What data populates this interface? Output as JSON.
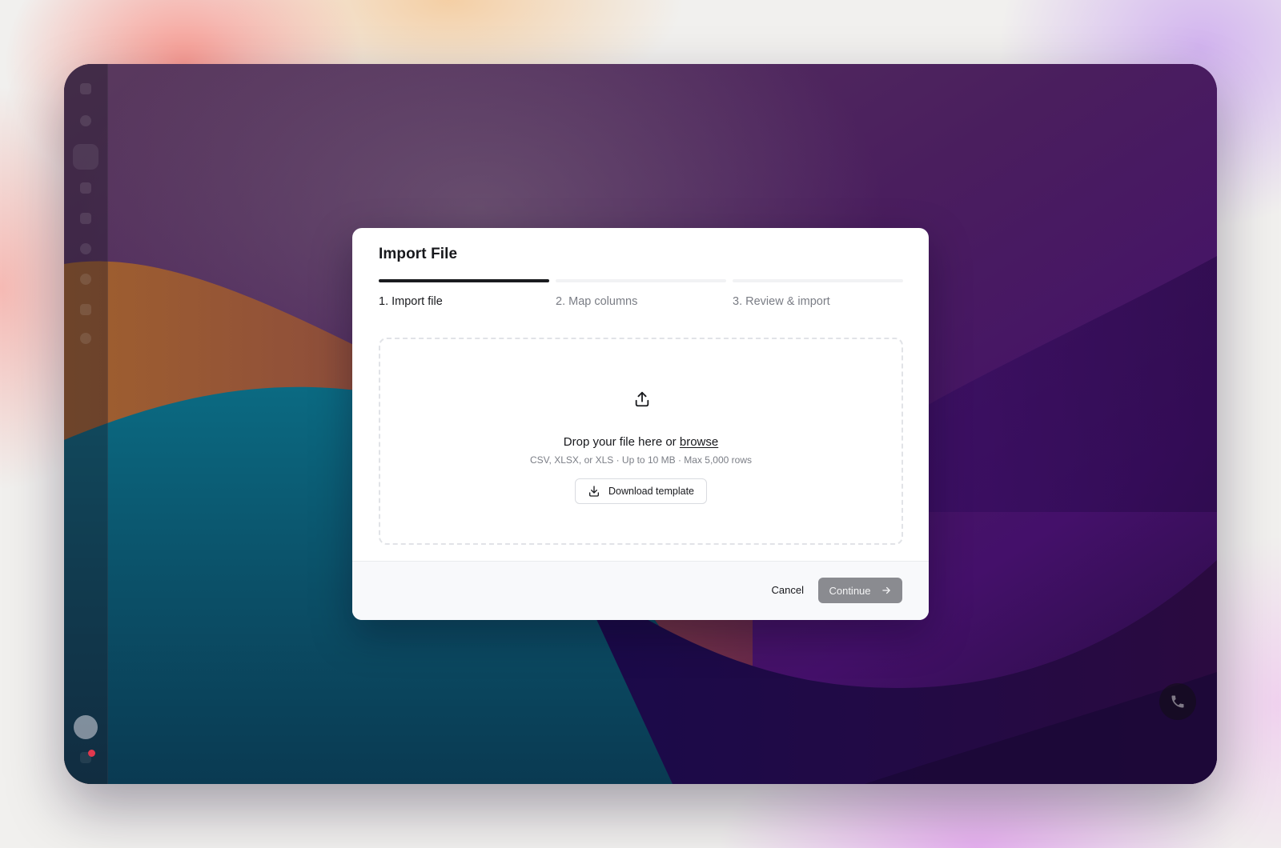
{
  "modal": {
    "title": "Import File",
    "steps": [
      {
        "label": "1. Import file",
        "state": "active"
      },
      {
        "label": "2. Map columns",
        "state": "upcoming"
      },
      {
        "label": "3. Review & import",
        "state": "upcoming"
      }
    ],
    "dropzone": {
      "icon": "upload-icon",
      "prompt": "Drop your file here or",
      "browse_label": "browse",
      "hint": "CSV, XLSX, or XLS · Up to 10 MB · Max 5,000 rows",
      "template_button": {
        "icon": "download-icon",
        "label": "Download template"
      }
    },
    "footer": {
      "cancel_label": "Cancel",
      "continue_label": "Continue",
      "continue_icon": "arrow-right-icon"
    }
  },
  "background": {
    "sidebar_icons": [
      "logo-icon",
      "search-icon",
      "edit-icon",
      "inbox-icon",
      "folder-icon",
      "chat-icon",
      "calendar-icon",
      "list-icon",
      "help-icon"
    ],
    "call_button_icon": "phone-icon"
  },
  "colors": {
    "primary_dark": "#1a1b1f",
    "continue_disabled": "#8a8b90",
    "muted_text": "#7a7d85",
    "dropzone_border": "#e1e3e7"
  }
}
